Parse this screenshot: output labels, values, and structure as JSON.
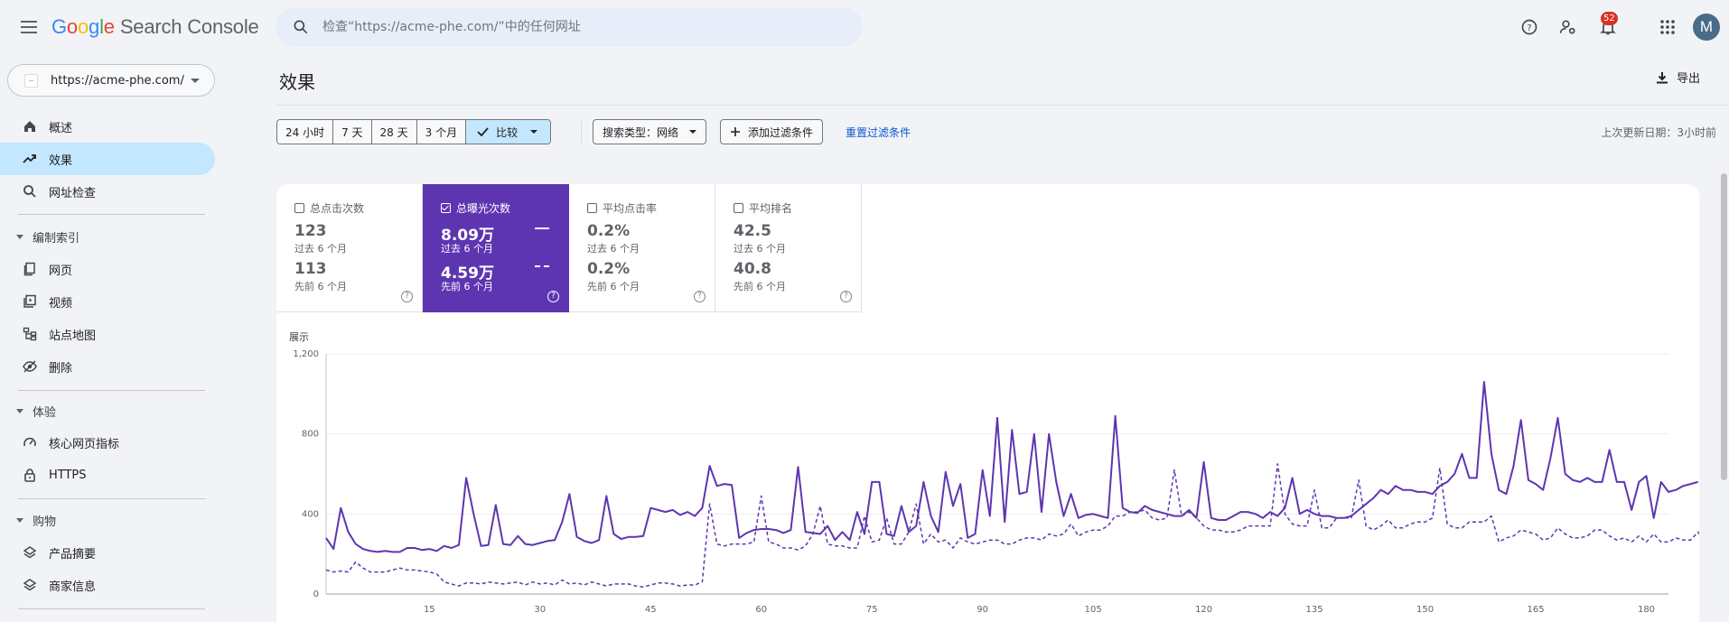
{
  "app": {
    "title_google": [
      "G",
      "o",
      "o",
      "g",
      "l",
      "e"
    ],
    "title_product": "Search Console",
    "search_placeholder": "检查“https://acme-phe.com/”中的任何网址",
    "notification_count": "52",
    "avatar_letter": "M"
  },
  "sidebar": {
    "property_url": "https://acme-phe.com/",
    "items": [
      {
        "label": "概述",
        "icon": "home-icon"
      },
      {
        "label": "效果",
        "icon": "trending-up-icon",
        "active": true
      },
      {
        "label": "网址检查",
        "icon": "search-icon"
      }
    ],
    "sections": [
      {
        "label": "编制索引",
        "items": [
          {
            "label": "网页",
            "icon": "pages-icon"
          },
          {
            "label": "视频",
            "icon": "video-icon"
          },
          {
            "label": "站点地图",
            "icon": "sitemap-icon"
          },
          {
            "label": "删除",
            "icon": "removal-icon"
          }
        ]
      },
      {
        "label": "体验",
        "items": [
          {
            "label": "核心网页指标",
            "icon": "speed-gauge-icon"
          },
          {
            "label": "HTTPS",
            "icon": "lock-icon"
          }
        ]
      },
      {
        "label": "购物",
        "items": [
          {
            "label": "产品摘要",
            "icon": "layers-icon"
          },
          {
            "label": "商家信息",
            "icon": "layers-icon"
          }
        ]
      }
    ]
  },
  "page": {
    "title": "效果",
    "export_label": "导出",
    "date_ranges": [
      "24 小时",
      "7 天",
      "28 天",
      "3 个月"
    ],
    "compare_label": "比较",
    "search_type_label": "搜索类型：网络",
    "add_filter_label": "添加过滤条件",
    "reset_label": "重置过滤条件",
    "last_updated": "上次更新日期：3小时前"
  },
  "metrics": [
    {
      "label": "总点击次数",
      "current": "123",
      "current_period": "过去 6 个月",
      "previous": "113",
      "previous_period": "先前 6 个月",
      "active": false
    },
    {
      "label": "总曝光次数",
      "current": "8.09万",
      "current_period": "过去 6 个月",
      "previous": "4.59万",
      "previous_period": "先前 6 个月",
      "active": true
    },
    {
      "label": "平均点击率",
      "current": "0.2%",
      "current_period": "过去 6 个月",
      "previous": "0.2%",
      "previous_period": "先前 6 个月",
      "active": false
    },
    {
      "label": "平均排名",
      "current": "42.5",
      "current_period": "过去 6 个月",
      "previous": "40.8",
      "previous_period": "先前 6 个月",
      "active": false
    }
  ],
  "colors": {
    "accent": "#5e35b1",
    "active_nav": "#c2e7ff",
    "link": "#0b57d0"
  },
  "chart_data": {
    "type": "line",
    "ylabel": "展示",
    "ylim": [
      0,
      1200
    ],
    "yticks": [
      0,
      400,
      800,
      1200
    ],
    "ytick_labels": [
      "0",
      "400",
      "800",
      "1,200"
    ],
    "xlim": [
      1,
      183
    ],
    "xticks": [
      15,
      30,
      45,
      60,
      75,
      90,
      105,
      120,
      135,
      150,
      165,
      180
    ],
    "grid": true,
    "series": [
      {
        "style": "solid",
        "values": [
          280,
          225,
          430,
          310,
          250,
          225,
          215,
          210,
          215,
          210,
          210,
          230,
          230,
          220,
          225,
          215,
          240,
          230,
          245,
          580,
          400,
          240,
          245,
          445,
          250,
          245,
          290,
          250,
          245,
          255,
          265,
          270,
          360,
          500,
          285,
          265,
          255,
          270,
          490,
          300,
          275,
          285,
          285,
          290,
          430,
          420,
          410,
          420,
          395,
          410,
          390,
          430,
          640,
          540,
          550,
          545,
          280,
          305,
          320,
          325,
          325,
          320,
          305,
          320,
          635,
          310,
          305,
          300,
          340,
          270,
          310,
          270,
          410,
          300,
          560,
          560,
          300,
          290,
          440,
          310,
          340,
          560,
          390,
          310,
          610,
          440,
          550,
          280,
          300,
          620,
          390,
          880,
          360,
          820,
          500,
          510,
          800,
          410,
          800,
          560,
          390,
          500,
          380,
          395,
          400,
          390,
          380,
          890,
          430,
          410,
          405,
          440,
          420,
          410,
          400,
          390,
          390,
          420,
          380,
          660,
          380,
          370,
          370,
          390,
          410,
          410,
          400,
          380,
          410,
          390,
          430,
          580,
          400,
          420,
          400,
          390,
          390,
          380,
          380,
          390,
          420,
          450,
          480,
          520,
          500,
          540,
          520,
          520,
          510,
          510,
          500,
          540,
          560,
          600,
          700,
          580,
          580,
          1060,
          700,
          520,
          500,
          640,
          870,
          570,
          550,
          520,
          680,
          880,
          600,
          570,
          560,
          580,
          560,
          560,
          720,
          560,
          560,
          420,
          560,
          590,
          380,
          560,
          510,
          520,
          540,
          550,
          560
        ]
      },
      {
        "style": "dashed",
        "values": [
          120,
          110,
          115,
          110,
          160,
          130,
          110,
          110,
          110,
          120,
          130,
          120,
          120,
          115,
          110,
          100,
          60,
          50,
          40,
          55,
          55,
          50,
          60,
          55,
          50,
          55,
          60,
          45,
          60,
          50,
          55,
          45,
          70,
          50,
          55,
          45,
          60,
          50,
          40,
          50,
          50,
          50,
          40,
          35,
          45,
          55,
          55,
          50,
          40,
          45,
          45,
          60,
          450,
          250,
          240,
          250,
          250,
          250,
          260,
          490,
          260,
          250,
          230,
          230,
          220,
          240,
          300,
          440,
          250,
          240,
          240,
          230,
          230,
          390,
          260,
          270,
          380,
          250,
          250,
          310,
          450,
          250,
          300,
          260,
          270,
          230,
          280,
          260,
          250,
          260,
          270,
          270,
          250,
          250,
          270,
          280,
          280,
          270,
          300,
          290,
          300,
          350,
          290,
          310,
          320,
          320,
          340,
          390,
          390,
          410,
          410,
          420,
          380,
          370,
          380,
          620,
          390,
          410,
          380,
          340,
          320,
          320,
          310,
          310,
          320,
          340,
          340,
          340,
          340,
          650,
          400,
          350,
          340,
          340,
          520,
          330,
          330,
          380,
          380,
          380,
          570,
          340,
          320,
          340,
          370,
          330,
          330,
          350,
          360,
          360,
          380,
          630,
          350,
          330,
          330,
          360,
          360,
          360,
          390,
          260,
          280,
          290,
          320,
          310,
          300,
          270,
          280,
          330,
          300,
          280,
          280,
          290,
          320,
          320,
          290,
          270,
          280,
          260,
          290,
          260,
          300,
          260,
          260,
          280,
          270,
          270,
          310,
          260,
          270,
          260,
          300,
          300,
          350
        ]
      }
    ]
  }
}
